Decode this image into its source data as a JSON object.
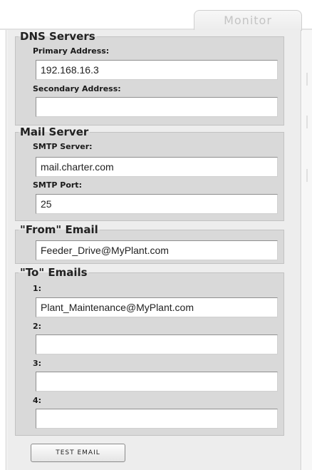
{
  "tabs": {
    "monitor_label": "Monitor"
  },
  "dns": {
    "legend": "DNS Servers",
    "primary_label": "Primary Address:",
    "primary_value": "192.168.16.3",
    "secondary_label": "Secondary Address:",
    "secondary_value": ""
  },
  "mail": {
    "legend": "Mail Server",
    "smtp_server_label": "SMTP Server:",
    "smtp_server_value": "mail.charter.com",
    "smtp_port_label": "SMTP Port:",
    "smtp_port_value": "25"
  },
  "from_email": {
    "legend": "\"From\" Email",
    "value": "Feeder_Drive@MyPlant.com"
  },
  "to_emails": {
    "legend": "\"To\" Emails",
    "items": [
      {
        "label": "1:",
        "value": "Plant_Maintenance@MyPlant.com"
      },
      {
        "label": "2:",
        "value": ""
      },
      {
        "label": "3:",
        "value": ""
      },
      {
        "label": "4:",
        "value": ""
      }
    ]
  },
  "actions": {
    "test_email_label": "TEST EMAIL"
  }
}
